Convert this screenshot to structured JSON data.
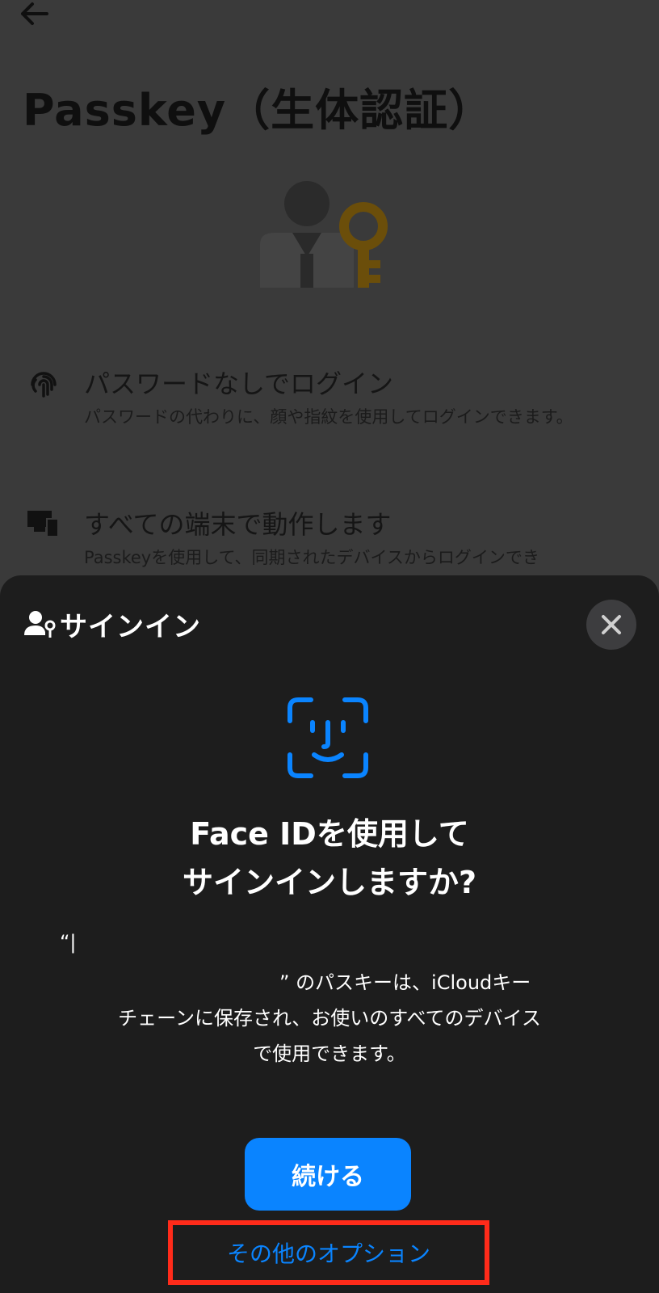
{
  "background_page": {
    "title": "Passkey（生体認証）",
    "features": [
      {
        "icon": "fingerprint-icon",
        "title": "パスワードなしでログイン",
        "description": "パスワードの代わりに、顔や指紋を使用してログインできます。"
      },
      {
        "icon": "devices-icon",
        "title": "すべての端末で動作します",
        "description": "Passkeyを使用して、同期されたデバイスからログインでき"
      }
    ]
  },
  "sheet": {
    "title": "サインイン",
    "close_icon": "close-icon",
    "faceid_icon": "face-id-icon",
    "heading_line1": "Face IDを使用して",
    "heading_line2": "サインインしますか?",
    "desc_open_quote": "“|",
    "desc_line1": "” のパスキーは、iCloudキー",
    "desc_line2": "チェーンに保存され、お使いのすべてのデバイス",
    "desc_line3": "で使用できます。",
    "continue_label": "続ける",
    "other_options_label": "その他のオプション"
  },
  "colors": {
    "accent": "#0a84ff",
    "highlight": "#ff2b1a",
    "hero_key": "#b07d12"
  }
}
